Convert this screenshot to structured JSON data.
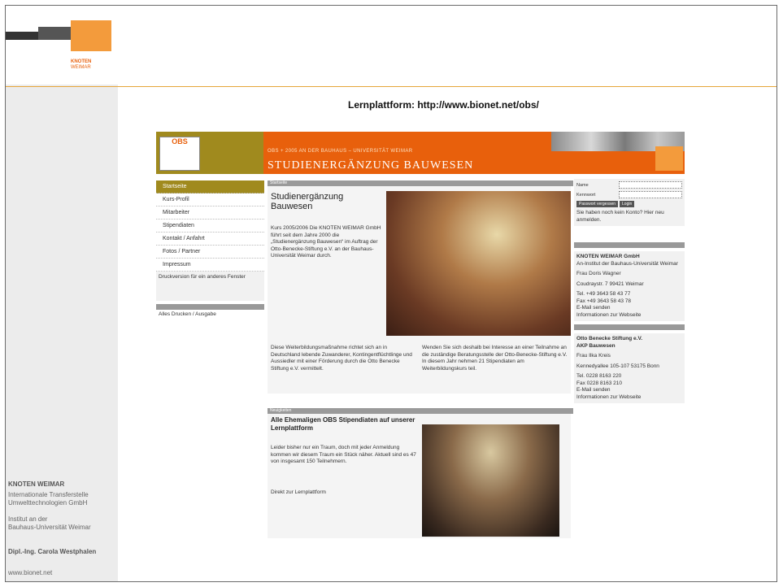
{
  "slide": {
    "headline": "Lernplattform:  http://www.bionet.net/obs/",
    "logo_text": "KNOTEN WEIMAR",
    "sidebar": {
      "org": "KNOTEN WEIMAR",
      "line1": "Internationale Transferstelle",
      "line2": "Umwelttechnologien GmbH",
      "line3": "Institut an der",
      "line4": "Bauhaus-Universität Weimar",
      "person": "Dipl.-Ing. Carola Westphalen",
      "url": "www.bionet.net"
    }
  },
  "site": {
    "logo": "OBS",
    "subtitle": "OBS + 2005 AN DER BAUHAUS – UNIVERSITÄT WEIMAR",
    "title": "STUDIENERGÄNZUNG BAUWESEN",
    "nav": [
      "Startseite",
      "Kurs-Profil",
      "Mitarbeiter",
      "Stipendiaten",
      "Kontakt / Anfahrt",
      "Fotos / Partner",
      "Impressum"
    ],
    "nav_note": "Druckversion für ein anderes Fenster",
    "nav_link": "Alles Drucken / Ausgabe",
    "main_head": "Startseite",
    "main_title": "Studienergänzung Bauwesen",
    "main_intro": "Kurs 2005/2006 Die KNOTEN WEIMAR GmbH führt seit dem Jahre 2000 die „Studienergänzung Bauwesen“ im Auftrag der Otto-Benecke-Stiftung e.V. an der Bauhaus-Universität Weimar durch.",
    "main_left": "Diese Weiterbildungsmaßnahme richtet sich an in Deutschland lebende Zuwanderer, Kontingentflüchtlinge und Aussiedler mit einer Förderung durch die Otto Benecke Stiftung e.V. vermittelt.",
    "main_right": "Wenden Sie sich deshalb bei Interesse an einer Teilnahme an die zuständige Beratungsstelle der Otto-Benecke-Stiftung e.V. In diesem Jahr nehmen 21 Stipendiaten am Weiterbildungskurs teil.",
    "news_head": "Neuigkeiten",
    "news_title": "Alle Ehemaligen OBS Stipendiaten auf unserer Lernplattform",
    "news_body": "Leider bisher nur ein Traum, doch mit jeder Anmeldung kommen wir diesem Traum ein Stück näher. Aktuell sind es 47 von insgesamt 150 Teilnehmern.",
    "news_link": "Direkt zur Lernplattform",
    "login": {
      "name_label": "Name",
      "pass_label": "Kennwort",
      "forgot": "Passwort vergessen",
      "login_btn": "Login",
      "register": "Sie haben noch kein Konto? Hier neu anmelden."
    },
    "contact1": {
      "org": "KNOTEN WEIMAR GmbH",
      "sub": "An-Institut der Bauhaus-Universität Weimar",
      "person": "Frau Doris Wagner",
      "addr": "Coudraystr. 7 99421 Weimar",
      "phone": "Tel. +49 3643 58 43 77",
      "fax": "Fax +49 3643 58 43 78",
      "mail": "E-Mail senden",
      "web": "Informationen zur Webseite"
    },
    "contact2": {
      "org": "Otto Benecke Stiftung e.V.",
      "sub": "AKP Bauwesen",
      "person": "Frau Ilka Kreis",
      "addr": "Kennedyallee 105-107 53175 Bonn",
      "phone": "Tel. 0228 8163 220",
      "fax": "Fax 0228 8163 210",
      "mail": "E-Mail senden",
      "web": "Informationen zur Webseite"
    }
  }
}
